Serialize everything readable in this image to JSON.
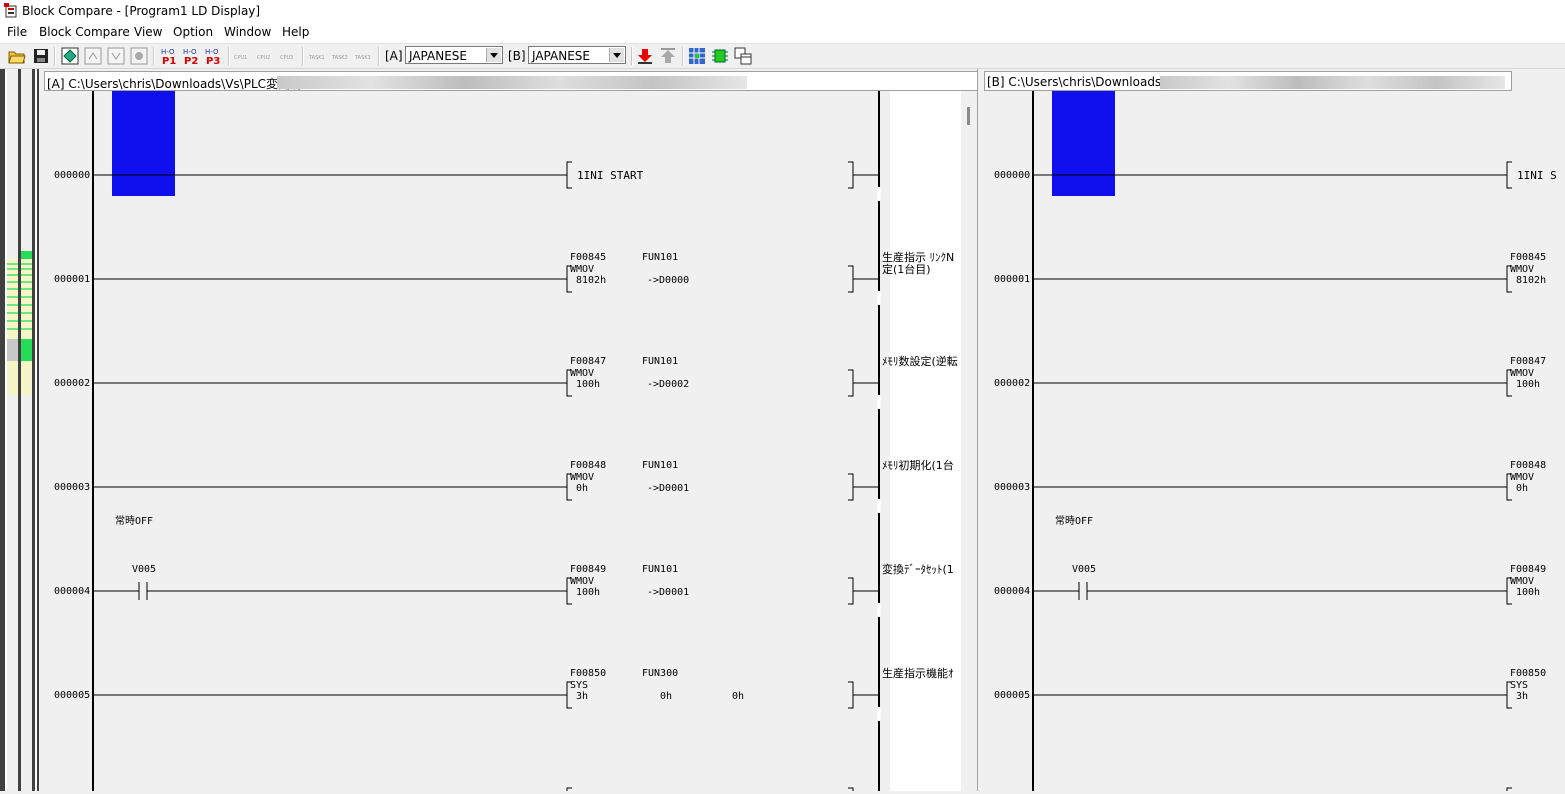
{
  "window": {
    "title": "Block Compare -  [Program1 LD  Display]"
  },
  "menu": [
    "File",
    "Block Compare",
    "View",
    "Option",
    "Window",
    "Help"
  ],
  "toolbar": {
    "label_a": "[A]",
    "label_b": "[B]",
    "language_a": "JAPANESE",
    "language_b": "JAPANESE",
    "cpu_buttons": [
      "CPU1",
      "CPU2",
      "CPU3"
    ],
    "task_buttons": [
      "TASK1",
      "TASK2",
      "TASK3"
    ],
    "p_buttons": [
      "P1",
      "P2",
      "P3"
    ]
  },
  "panel_a": {
    "path": "[A] C:\\Users\\chris\\Downloads\\Vs\\PLC変更前"
  },
  "panel_b": {
    "path": "[B] C:\\Users\\chris\\Downloads\\Vs\\"
  },
  "colors": {
    "highlight": "#1010ee",
    "overview_green": "#22dd55",
    "overview_yellow": "#f5f5c8"
  },
  "rungs": [
    {
      "num": "000000",
      "instr": "1INI   START"
    },
    {
      "num": "000001",
      "fid": "F00845",
      "fun": "FUN101",
      "op": "WMOV",
      "a1": "8102h",
      "a2": "->D0000",
      "comment": "生産指示 ﾘﾝｸN",
      "comment2": "定(1台目)"
    },
    {
      "num": "000002",
      "fid": "F00847",
      "fun": "FUN101",
      "op": "WMOV",
      "a1": "100h",
      "a2": "->D0002",
      "comment": "ﾒﾓﾘ数設定(逆転"
    },
    {
      "num": "000003",
      "fid": "F00848",
      "fun": "FUN101",
      "op": "WMOV",
      "a1": "0h",
      "a2": "->D0001",
      "comment": "ﾒﾓﾘ初期化(1台"
    },
    {
      "num": "000004",
      "fid": "F00849",
      "fun": "FUN101",
      "op": "WMOV",
      "a1": "100h",
      "a2": "->D0001",
      "comment": "変換ﾃﾞｰﾀｾｯﾄ(1",
      "contact": "V005",
      "contact_comment": "常時OFF"
    },
    {
      "num": "000005",
      "fid": "F00850",
      "fun": "FUN300",
      "op": "SYS",
      "a1": "3h",
      "a2": "0h",
      "a3": "0h",
      "comment": "生産指示機能ｵ"
    }
  ],
  "panel_b_visible": {
    "instr0": "1INI    S"
  }
}
